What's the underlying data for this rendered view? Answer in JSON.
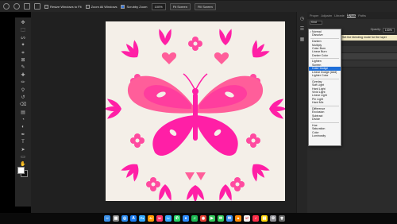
{
  "options_bar": {
    "resize_windows": "Resize Windows to Fit",
    "zoom_all": "Zoom All Windows",
    "scrubby_zoom": "Scrubby Zoom",
    "zoom_level": "100%",
    "fit_screen": "Fit Screen",
    "fill_screen": "Fill Screen"
  },
  "panel": {
    "tabs": [
      "Proper",
      "Adjustm",
      "Librarie",
      "Layers",
      "Paths"
    ],
    "active_tab": "Layers",
    "kind_filter": "Kind",
    "opacity_label": "Opacity:",
    "opacity_value": "100%",
    "tooltip": "Set the blending mode for the layer"
  },
  "blend_menu": {
    "groups": [
      [
        "Normal",
        "Dissolve"
      ],
      [
        "Darken",
        "Multiply",
        "Color Burn",
        "Linear Burn",
        "Darker Color"
      ],
      [
        "Lighten",
        "Screen",
        "Color Dodge",
        "Linear Dodge (Add)",
        "Lighter Color"
      ],
      [
        "Overlay",
        "Soft Light",
        "Hard Light",
        "Vivid Light",
        "Linear Light",
        "Pin Light",
        "Hard Mix"
      ],
      [
        "Difference",
        "Exclusion",
        "Subtract",
        "Divide"
      ],
      [
        "Hue",
        "Saturation",
        "Color",
        "Luminosity"
      ]
    ],
    "checked": "Normal",
    "highlighted": "Color Dodge"
  },
  "colors": {
    "accent": "#1e6ed8",
    "magenta": "#ff1fa6",
    "pink": "#ff5e9a",
    "canvas": "#f4efe8"
  },
  "tools": [
    "move-tool",
    "marquee-tool",
    "lasso-tool",
    "magic-wand-tool",
    "crop-tool",
    "frame-tool",
    "eyedropper-tool",
    "healing-tool",
    "brush-tool",
    "stamp-tool",
    "history-brush-tool",
    "eraser-tool",
    "gradient-tool",
    "blur-tool",
    "dodge-tool",
    "pen-tool",
    "type-tool",
    "path-select-tool",
    "shape-tool",
    "hand-tool",
    "zoom-tool"
  ],
  "dock_apps": [
    "finder",
    "launchpad",
    "safari",
    "app-store",
    "photoshop",
    "illustrator",
    "indesign",
    "lightroom",
    "whatsapp",
    "zoom",
    "spotify",
    "chrome",
    "facetime",
    "messages",
    "mail",
    "vlc",
    "calendar",
    "music",
    "notes",
    "system-preferences",
    "trash"
  ]
}
